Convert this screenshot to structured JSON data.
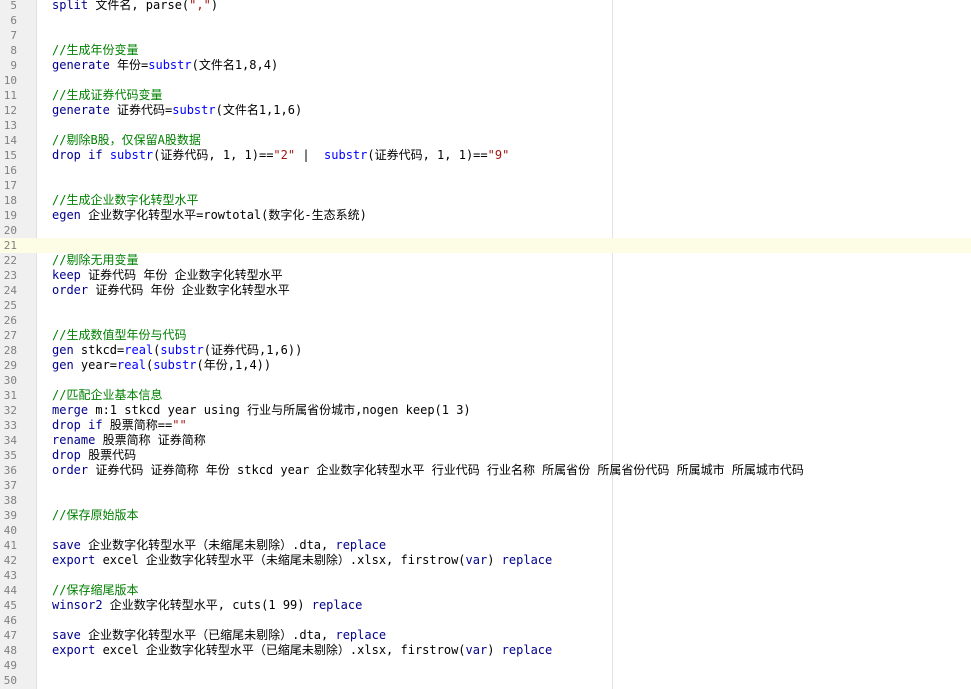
{
  "editor": {
    "colors": {
      "keyword": "#00008b",
      "function": "#0000ff",
      "comment": "#008000",
      "string": "#a31515",
      "text": "#000000",
      "line_number": "#808080",
      "current_line_bg": "#fdfde5"
    },
    "current_line": 21,
    "lines": [
      {
        "n": "5",
        "tokens": [
          {
            "t": "kw",
            "v": "split"
          },
          {
            "t": "",
            "v": " 文件名, parse("
          },
          {
            "t": "st",
            "v": "\",\""
          },
          {
            "t": "",
            "v": ")"
          }
        ]
      },
      {
        "n": "6",
        "tokens": []
      },
      {
        "n": "7",
        "tokens": []
      },
      {
        "n": "8",
        "tokens": [
          {
            "t": "cm",
            "v": "//生成年份变量"
          }
        ]
      },
      {
        "n": "9",
        "tokens": [
          {
            "t": "kw",
            "v": "generate"
          },
          {
            "t": "",
            "v": " 年份="
          },
          {
            "t": "fn",
            "v": "substr"
          },
          {
            "t": "",
            "v": "(文件名1,8,4)"
          }
        ]
      },
      {
        "n": "10",
        "tokens": []
      },
      {
        "n": "11",
        "tokens": [
          {
            "t": "cm",
            "v": "//生成证券代码变量"
          }
        ]
      },
      {
        "n": "12",
        "tokens": [
          {
            "t": "kw",
            "v": "generate"
          },
          {
            "t": "",
            "v": " 证券代码="
          },
          {
            "t": "fn",
            "v": "substr"
          },
          {
            "t": "",
            "v": "(文件名1,1,6)"
          }
        ]
      },
      {
        "n": "13",
        "tokens": []
      },
      {
        "n": "14",
        "tokens": [
          {
            "t": "cm",
            "v": "//剔除B股，仅保留A股数据"
          }
        ]
      },
      {
        "n": "15",
        "tokens": [
          {
            "t": "kw",
            "v": "drop if"
          },
          {
            "t": "",
            "v": " "
          },
          {
            "t": "fn",
            "v": "substr"
          },
          {
            "t": "",
            "v": "(证券代码, 1, 1)=="
          },
          {
            "t": "st",
            "v": "\"2\""
          },
          {
            "t": "",
            "v": " |  "
          },
          {
            "t": "fn",
            "v": "substr"
          },
          {
            "t": "",
            "v": "(证券代码, 1, 1)=="
          },
          {
            "t": "st",
            "v": "\"9\""
          }
        ]
      },
      {
        "n": "16",
        "tokens": []
      },
      {
        "n": "17",
        "tokens": []
      },
      {
        "n": "18",
        "tokens": [
          {
            "t": "cm",
            "v": "//生成企业数字化转型水平"
          }
        ]
      },
      {
        "n": "19",
        "tokens": [
          {
            "t": "kw",
            "v": "egen"
          },
          {
            "t": "",
            "v": " 企业数字化转型水平=rowtotal(数字化-生态系统)"
          }
        ]
      },
      {
        "n": "20",
        "tokens": []
      },
      {
        "n": "21",
        "tokens": []
      },
      {
        "n": "22",
        "tokens": [
          {
            "t": "cm",
            "v": "//剔除无用变量"
          }
        ]
      },
      {
        "n": "23",
        "tokens": [
          {
            "t": "kw",
            "v": "keep"
          },
          {
            "t": "",
            "v": " 证券代码 年份 企业数字化转型水平"
          }
        ]
      },
      {
        "n": "24",
        "tokens": [
          {
            "t": "kw",
            "v": "order"
          },
          {
            "t": "",
            "v": " 证券代码 年份 企业数字化转型水平"
          }
        ]
      },
      {
        "n": "25",
        "tokens": []
      },
      {
        "n": "26",
        "tokens": []
      },
      {
        "n": "27",
        "tokens": [
          {
            "t": "cm",
            "v": "//生成数值型年份与代码"
          }
        ]
      },
      {
        "n": "28",
        "tokens": [
          {
            "t": "kw",
            "v": "gen"
          },
          {
            "t": "",
            "v": " stkcd="
          },
          {
            "t": "fn",
            "v": "real"
          },
          {
            "t": "",
            "v": "("
          },
          {
            "t": "fn",
            "v": "substr"
          },
          {
            "t": "",
            "v": "(证券代码,1,6))"
          }
        ]
      },
      {
        "n": "29",
        "tokens": [
          {
            "t": "kw",
            "v": "gen"
          },
          {
            "t": "",
            "v": " year="
          },
          {
            "t": "fn",
            "v": "real"
          },
          {
            "t": "",
            "v": "("
          },
          {
            "t": "fn",
            "v": "substr"
          },
          {
            "t": "",
            "v": "(年份,1,4))"
          }
        ]
      },
      {
        "n": "30",
        "tokens": []
      },
      {
        "n": "31",
        "tokens": [
          {
            "t": "cm",
            "v": "//匹配企业基本信息"
          }
        ]
      },
      {
        "n": "32",
        "tokens": [
          {
            "t": "kw",
            "v": "merge"
          },
          {
            "t": "",
            "v": " m:1 stkcd year using 行业与所属省份城市,nogen keep(1 3)"
          }
        ]
      },
      {
        "n": "33",
        "tokens": [
          {
            "t": "kw",
            "v": "drop if"
          },
          {
            "t": "",
            "v": " 股票简称=="
          },
          {
            "t": "st",
            "v": "\"\""
          }
        ]
      },
      {
        "n": "34",
        "tokens": [
          {
            "t": "kw",
            "v": "rename"
          },
          {
            "t": "",
            "v": " 股票简称 证券简称"
          }
        ]
      },
      {
        "n": "35",
        "tokens": [
          {
            "t": "kw",
            "v": "drop"
          },
          {
            "t": "",
            "v": " 股票代码"
          }
        ]
      },
      {
        "n": "36",
        "tokens": [
          {
            "t": "kw",
            "v": "order"
          },
          {
            "t": "",
            "v": " 证券代码 证券简称 年份 stkcd year 企业数字化转型水平 行业代码 行业名称 所属省份 所属省份代码 所属城市 所属城市代码"
          }
        ]
      },
      {
        "n": "37",
        "tokens": []
      },
      {
        "n": "38",
        "tokens": []
      },
      {
        "n": "39",
        "tokens": [
          {
            "t": "cm",
            "v": "//保存原始版本"
          }
        ]
      },
      {
        "n": "40",
        "tokens": []
      },
      {
        "n": "41",
        "tokens": [
          {
            "t": "kw",
            "v": "save"
          },
          {
            "t": "",
            "v": " 企业数字化转型水平（未缩尾未剔除）.dta, "
          },
          {
            "t": "kw",
            "v": "replace"
          }
        ]
      },
      {
        "n": "42",
        "tokens": [
          {
            "t": "kw",
            "v": "export"
          },
          {
            "t": "",
            "v": " excel 企业数字化转型水平（未缩尾未剔除）.xlsx, firstrow("
          },
          {
            "t": "kw",
            "v": "var"
          },
          {
            "t": "",
            "v": ") "
          },
          {
            "t": "kw",
            "v": "replace"
          }
        ]
      },
      {
        "n": "43",
        "tokens": []
      },
      {
        "n": "44",
        "tokens": [
          {
            "t": "cm",
            "v": "//保存缩尾版本"
          }
        ]
      },
      {
        "n": "45",
        "tokens": [
          {
            "t": "kw",
            "v": "winsor2"
          },
          {
            "t": "",
            "v": " 企业数字化转型水平, cuts(1 99) "
          },
          {
            "t": "kw",
            "v": "replace"
          }
        ]
      },
      {
        "n": "46",
        "tokens": []
      },
      {
        "n": "47",
        "tokens": [
          {
            "t": "kw",
            "v": "save"
          },
          {
            "t": "",
            "v": " 企业数字化转型水平（已缩尾未剔除）.dta, "
          },
          {
            "t": "kw",
            "v": "replace"
          }
        ]
      },
      {
        "n": "48",
        "tokens": [
          {
            "t": "kw",
            "v": "export"
          },
          {
            "t": "",
            "v": " excel 企业数字化转型水平（已缩尾未剔除）.xlsx, firstrow("
          },
          {
            "t": "kw",
            "v": "var"
          },
          {
            "t": "",
            "v": ") "
          },
          {
            "t": "kw",
            "v": "replace"
          }
        ]
      },
      {
        "n": "49",
        "tokens": []
      },
      {
        "n": "50",
        "tokens": []
      }
    ]
  }
}
